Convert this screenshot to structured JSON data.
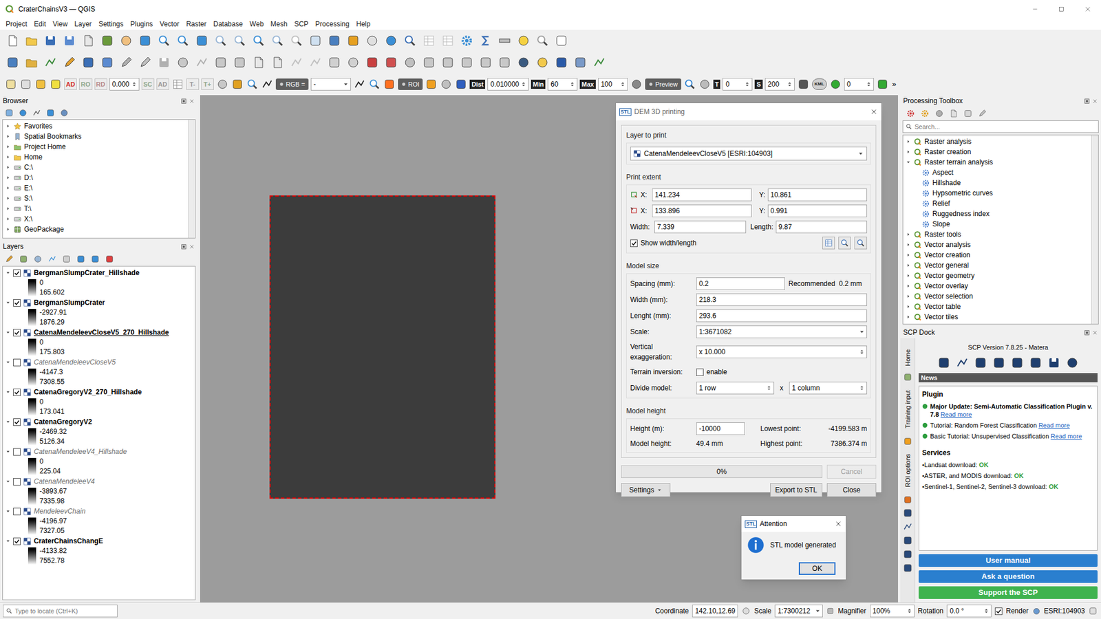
{
  "window": {
    "title": "CraterChainsV3 — QGIS"
  },
  "menu": [
    "Project",
    "Edit",
    "View",
    "Layer",
    "Settings",
    "Plugins",
    "Vector",
    "Raster",
    "Database",
    "Web",
    "Mesh",
    "SCP",
    "Processing",
    "Help"
  ],
  "toolbar3": [
    {
      "kind": "icon"
    },
    {
      "kind": "icon"
    },
    {
      "kind": "icon"
    },
    {
      "kind": "icon"
    },
    {
      "kind": "tag",
      "text": "AD",
      "color": "#d42a2a"
    },
    {
      "kind": "tag",
      "text": "RO",
      "color": "#8fa88f"
    },
    {
      "kind": "tag",
      "text": "RD",
      "color": "#b58a8a"
    },
    {
      "kind": "field",
      "text": "0.000"
    },
    {
      "kind": "tag",
      "text": "SC",
      "color": "#8fa88f"
    },
    {
      "kind": "tag",
      "text": "AD",
      "color": "#9a9a9a"
    },
    {
      "kind": "icon"
    },
    {
      "kind": "tag",
      "text": "T-",
      "color": "#9a9a9a"
    },
    {
      "kind": "tag",
      "text": "T+",
      "color": "#8fa88f"
    },
    {
      "kind": "icon"
    },
    {
      "kind": "icon"
    },
    {
      "kind": "icon"
    },
    {
      "kind": "icon"
    },
    {
      "kind": "toggle",
      "text": "RGB ="
    },
    {
      "kind": "combo",
      "text": "-"
    },
    {
      "kind": "icon"
    },
    {
      "kind": "icon"
    },
    {
      "kind": "icon"
    },
    {
      "kind": "toggle",
      "text": "ROI"
    },
    {
      "kind": "icon"
    },
    {
      "kind": "icon"
    },
    {
      "kind": "icon"
    },
    {
      "kind": "label",
      "text": "Dist"
    },
    {
      "kind": "field",
      "text": "0.010000"
    },
    {
      "kind": "label",
      "text": "Min"
    },
    {
      "kind": "field",
      "text": "60"
    },
    {
      "kind": "label",
      "text": "Max"
    },
    {
      "kind": "field",
      "text": "100"
    },
    {
      "kind": "icon"
    },
    {
      "kind": "toggle",
      "text": "Preview"
    },
    {
      "kind": "icon"
    },
    {
      "kind": "icon"
    },
    {
      "kind": "label",
      "text": "T"
    },
    {
      "kind": "field",
      "text": "0"
    },
    {
      "kind": "label",
      "text": "S"
    },
    {
      "kind": "field",
      "text": "200"
    },
    {
      "kind": "icon"
    },
    {
      "kind": "badge",
      "text": "KML"
    },
    {
      "kind": "icon"
    },
    {
      "kind": "field",
      "text": "0"
    },
    {
      "kind": "icon"
    },
    {
      "kind": "overflow",
      "text": "»"
    }
  ],
  "browser": {
    "title": "Browser",
    "items": [
      "Favorites",
      "Spatial Bookmarks",
      "Project Home",
      "Home",
      "C:\\",
      "D:\\",
      "E:\\",
      "S:\\",
      "T:\\",
      "X:\\",
      "GeoPackage"
    ]
  },
  "layers_panel": {
    "title": "Layers"
  },
  "layers": [
    {
      "name": "BergmanSlumpCrater_Hillshade",
      "visible": true,
      "current": false,
      "expanded": true,
      "min": "0",
      "max": "165.602"
    },
    {
      "name": "BergmanSlumpCrater",
      "visible": true,
      "current": false,
      "expanded": true,
      "min": "-2927.91",
      "max": "1876.29"
    },
    {
      "name": "CatenaMendeleevCloseV5_270_Hillshade",
      "visible": true,
      "current": true,
      "expanded": true,
      "min": "0",
      "max": "175.803"
    },
    {
      "name": "CatenaMendeleevCloseV5",
      "visible": false,
      "current": false,
      "expanded": true,
      "min": "-4147.3",
      "max": "7308.55"
    },
    {
      "name": "CatenaGregoryV2_270_Hillshade",
      "visible": true,
      "current": false,
      "expanded": true,
      "min": "0",
      "max": "173.041"
    },
    {
      "name": "CatenaGregoryV2",
      "visible": true,
      "current": false,
      "expanded": true,
      "min": "-2469.32",
      "max": "5126.34"
    },
    {
      "name": "CatenaMendeleeV4_Hillshade",
      "visible": false,
      "current": false,
      "expanded": true,
      "min": "0",
      "max": "225.04"
    },
    {
      "name": "CatenaMendeleeV4",
      "visible": false,
      "current": false,
      "expanded": true,
      "min": "-3893.67",
      "max": "7335.98"
    },
    {
      "name": "MendeleevChain",
      "visible": false,
      "current": false,
      "expanded": true,
      "min": "-4196.97",
      "max": "7327.05"
    },
    {
      "name": "CraterChainsChangE",
      "visible": true,
      "current": false,
      "expanded": true,
      "min": "-4133.82",
      "max": "7552.78"
    }
  ],
  "toolbox": {
    "title": "Processing Toolbox",
    "search_placeholder": "Search...",
    "items": [
      {
        "label": "Raster analysis",
        "kind": "group",
        "expanded": false
      },
      {
        "label": "Raster creation",
        "kind": "group",
        "expanded": false
      },
      {
        "label": "Raster terrain analysis",
        "kind": "group",
        "expanded": true
      },
      {
        "label": "Aspect",
        "kind": "algorithm",
        "expanded": false
      },
      {
        "label": "Hillshade",
        "kind": "algorithm",
        "expanded": false
      },
      {
        "label": "Hypsometric curves",
        "kind": "algorithm",
        "expanded": false
      },
      {
        "label": "Relief",
        "kind": "algorithm",
        "expanded": false
      },
      {
        "label": "Ruggedness index",
        "kind": "algorithm",
        "expanded": false
      },
      {
        "label": "Slope",
        "kind": "algorithm",
        "expanded": false
      },
      {
        "label": "Raster tools",
        "kind": "group",
        "expanded": false
      },
      {
        "label": "Vector analysis",
        "kind": "group",
        "expanded": false
      },
      {
        "label": "Vector creation",
        "kind": "group",
        "expanded": false
      },
      {
        "label": "Vector general",
        "kind": "group",
        "expanded": false
      },
      {
        "label": "Vector geometry",
        "kind": "group",
        "expanded": false
      },
      {
        "label": "Vector overlay",
        "kind": "group",
        "expanded": false
      },
      {
        "label": "Vector selection",
        "kind": "group",
        "expanded": false
      },
      {
        "label": "Vector table",
        "kind": "group",
        "expanded": false
      },
      {
        "label": "Vector tiles",
        "kind": "group",
        "expanded": false
      }
    ]
  },
  "scp": {
    "title": "SCP Dock",
    "tabs": [
      "Home",
      "Training input",
      "ROI options"
    ],
    "version": "SCP Version 7.8.25 - Matera",
    "news_title": "News",
    "plugin_heading": "Plugin",
    "news": [
      {
        "text": "Major Update: Semi-Automatic Classification Plugin v. 7.8",
        "link": "Read more",
        "bold": true
      },
      {
        "text": "Tutorial: Random Forest Classification",
        "link": "Read more",
        "bold": false
      },
      {
        "text": "Basic Tutorial: Unsupervised Classification",
        "link": "Read more",
        "bold": false
      }
    ],
    "services_heading": "Services",
    "services": [
      {
        "text": "•Landsat download:",
        "status": "OK"
      },
      {
        "text": "•ASTER, and MODIS download:",
        "status": "OK"
      },
      {
        "text": "•Sentinel-1, Sentinel-2, Sentinel-3 download:",
        "status": "OK"
      }
    ],
    "buttons": [
      {
        "label": "User manual",
        "color": "#2a7fcf"
      },
      {
        "label": "Ask a question",
        "color": "#2a7fcf"
      },
      {
        "label": "Support the SCP",
        "color": "#3fb34f"
      }
    ]
  },
  "status_bar": {
    "search_placeholder": "Type to locate (Ctrl+K)",
    "coordinate_label": "Coordinate",
    "coordinate": "142.10,12.69",
    "scale_label": "Scale",
    "scale": "1:7300212",
    "magnifier_label": "Magnifier",
    "magnifier": "100%",
    "rotation_label": "Rotation",
    "rotation": "0.0 °",
    "render": {
      "label": "Render",
      "checked": true
    },
    "crs": "ESRI:104903"
  },
  "dem_dialog": {
    "icon": "STL",
    "title": "DEM 3D printing",
    "layer_group": "Layer to print",
    "layer": "CatenaMendeleevCloseV5 [ESRI:104903]",
    "extent_group": "Print extent",
    "extent_rows": [
      {
        "x_label": "X:",
        "x": "141.234",
        "y_label": "Y:",
        "y": "10.861"
      },
      {
        "x_label": "X:",
        "x": "133.896",
        "y_label": "Y:",
        "y": "0.991"
      }
    ],
    "width_label": "Width:",
    "width": "7.339",
    "length_label": "Length:",
    "length": "9.87",
    "show_wl": {
      "label": "Show width/length",
      "checked": true
    },
    "size_group": "Model size",
    "spacing": {
      "label": "Spacing (mm):",
      "value": "0.2",
      "note": "Recommended  0.2 mm"
    },
    "size_rows": [
      {
        "label": "Width (mm):",
        "value": "218.3",
        "kind": "field"
      },
      {
        "label": "Lenght (mm):",
        "value": "293.6",
        "kind": "field"
      },
      {
        "label": "Scale:",
        "value": "1:3671082",
        "kind": "combo"
      },
      {
        "label": "Vertical exaggeration:",
        "value": "x 10.000",
        "kind": "spin"
      }
    ],
    "inversion": {
      "label": "Terrain inversion:",
      "text": "enable",
      "checked": false
    },
    "divide": {
      "label": "Divide model:",
      "rows": "1 row",
      "x": "x",
      "cols": "1 column"
    },
    "height_group": "Model height",
    "height_label": "Height (m):",
    "height": "-10000",
    "lowest_label": "Lowest point:",
    "lowest": "-4199.583 m",
    "model_height_label": "Model height:",
    "model_height": "49.4 mm",
    "highest_label": "Highest point:",
    "highest": "7386.374 m",
    "progress": {
      "text": "0%",
      "level": 0
    },
    "cancel": {
      "label": "Cancel",
      "disabled": true
    },
    "buttons": [
      "Settings",
      "Export to STL",
      "Close"
    ]
  },
  "attention": {
    "icon": "STL",
    "title": "Attention",
    "message": "STL model generated",
    "button": "OK"
  }
}
